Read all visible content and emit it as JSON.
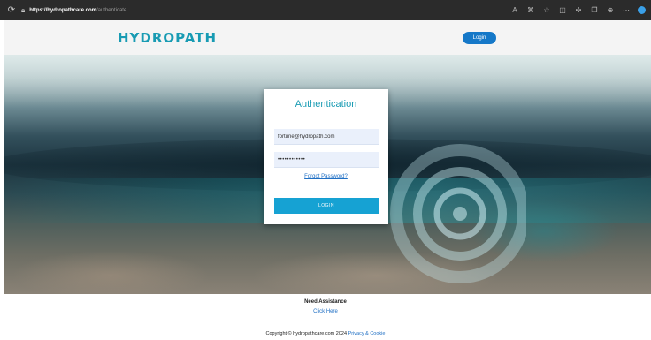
{
  "browser": {
    "url_host": "https://hydropathcare.com",
    "url_path": "/authenticate",
    "icons": [
      "refresh-icon",
      "lock-icon",
      "read-aloud-icon",
      "immersive-reader-icon",
      "favorite-star-icon",
      "split-screen-icon",
      "extensions-icon",
      "collections-icon",
      "sync-icon",
      "more-icon",
      "profile-icon"
    ]
  },
  "header": {
    "logo": "HYDROPATH",
    "login_label": "Login"
  },
  "auth": {
    "title": "Authentication",
    "email_value": "fortune@hydropath.com",
    "password_value": "••••••••••••",
    "forgot_label": "Forgot Password?",
    "login_label": "LOGIN"
  },
  "footer": {
    "assist_label": "Need Assistance",
    "click_here_label": "Click Here",
    "copyright_text": "Copyright © hydropathcare.com 2024",
    "privacy_label": "Privacy & Cookie"
  },
  "colors": {
    "brand": "#189bb3",
    "primary_button": "#16a2d3",
    "header_button": "#1578c8",
    "link": "#1f6fc4"
  }
}
